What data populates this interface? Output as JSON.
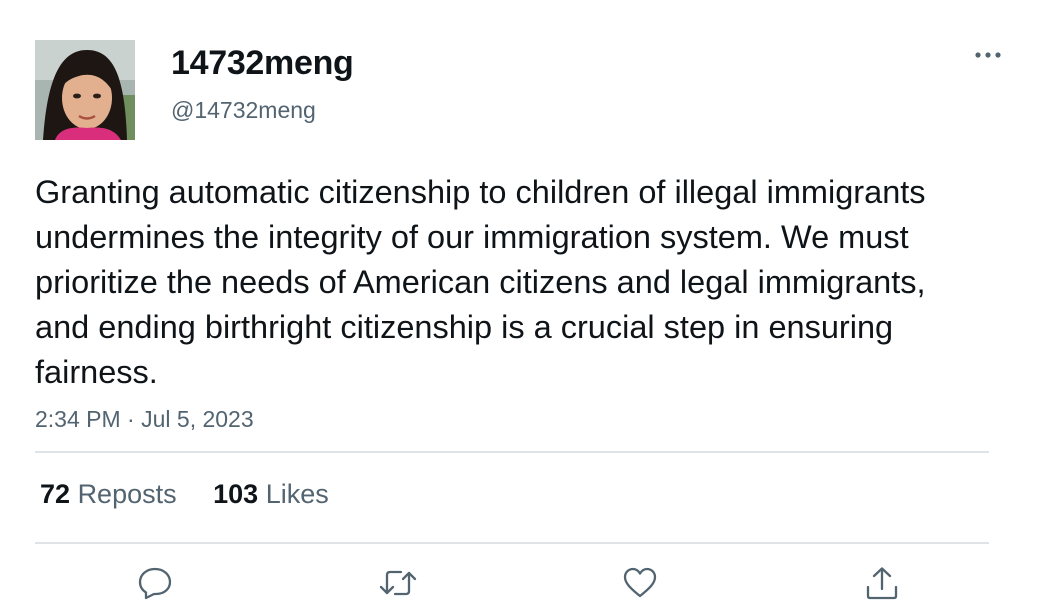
{
  "user": {
    "display_name": "14732meng",
    "handle": "@14732meng",
    "avatar_icon": "profile-photo"
  },
  "tweet": {
    "text": "Granting automatic citizenship to children of illegal immigrants undermines the integrity of our immigration system. We must prioritize the needs of American citizens and legal immigrants, and ending birthright citizenship is a crucial step in ensuring fairness.",
    "time": "2:34 PM",
    "separator": "·",
    "date": "Jul 5, 2023"
  },
  "stats": {
    "reposts_count": "72",
    "reposts_label": "Reposts",
    "likes_count": "103",
    "likes_label": "Likes"
  },
  "actions": {
    "more_icon": "more-horizontal-icon",
    "reply_icon": "reply-icon",
    "repost_icon": "repost-icon",
    "like_icon": "heart-icon",
    "share_icon": "share-icon"
  },
  "colors": {
    "text_primary": "#0f1419",
    "text_secondary": "#536471",
    "divider": "#dfe3e6",
    "background": "#ffffff"
  }
}
